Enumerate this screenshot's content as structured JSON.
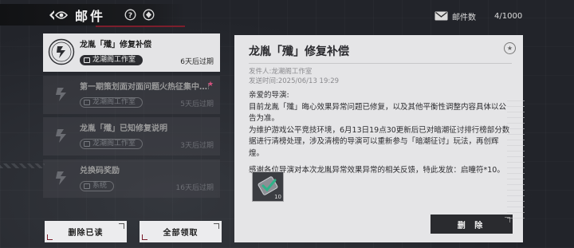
{
  "header": {
    "title": "邮件",
    "back_icon": "back-eye-icon",
    "help_icon": "question-icon",
    "filter_icon": "diamond-icon"
  },
  "mail_count": {
    "label": "邮件数",
    "value": "4/1000",
    "icon": "envelope-icon"
  },
  "mails": [
    {
      "title": "龙胤「殲」修复补偿",
      "sender": "龙潮阁工作室",
      "expire": "6天后过期",
      "selected": true,
      "read": false,
      "starred": false
    },
    {
      "title": "第一期策划面对面问题火热征集中…!",
      "sender": "龙潮阁工作室",
      "expire": "5天后过期",
      "selected": false,
      "read": true,
      "starred": true
    },
    {
      "title": "龙胤「殲」已知修复说明",
      "sender": "龙潮阁工作室",
      "expire": "3天后过期",
      "selected": false,
      "read": true,
      "starred": false
    },
    {
      "title": "兑换码奖励",
      "sender": "系统",
      "expire": "16天后过期",
      "selected": false,
      "read": true,
      "starred": false
    }
  ],
  "buttons": {
    "delete_read": "删除已读",
    "claim_all": "全部领取",
    "delete": "删 除"
  },
  "detail": {
    "title": "龙胤「殲」修复补偿",
    "sender_line": "发件人:龙潮阁工作室",
    "time_line": "发送时间:2025/06/13 19:29",
    "greeting": "亲爱的导演:",
    "paragraph1": "目前龙胤「殲」晦心效果异常问题已修复，以及其他平衡性调整内容具体以公告为准。",
    "paragraph2": "为维护游戏公平竞技环境，6月13日19点30更新后已对暗潮征讨排行榜部分数据进行清榜处理，涉及清榜的导演可以重新参与「暗潮征讨」玩法，再创辉煌。",
    "paragraph3": "感谢各位导演对本次龙胤异常效果异常的相关反馈，特此发放：启瞳符*10。",
    "attachment": {
      "icon": "check-ticket-icon",
      "count": "10"
    }
  },
  "colors": {
    "accent": "#7c1e2c",
    "panel": "#e5e5e7",
    "background": "#24262a"
  }
}
